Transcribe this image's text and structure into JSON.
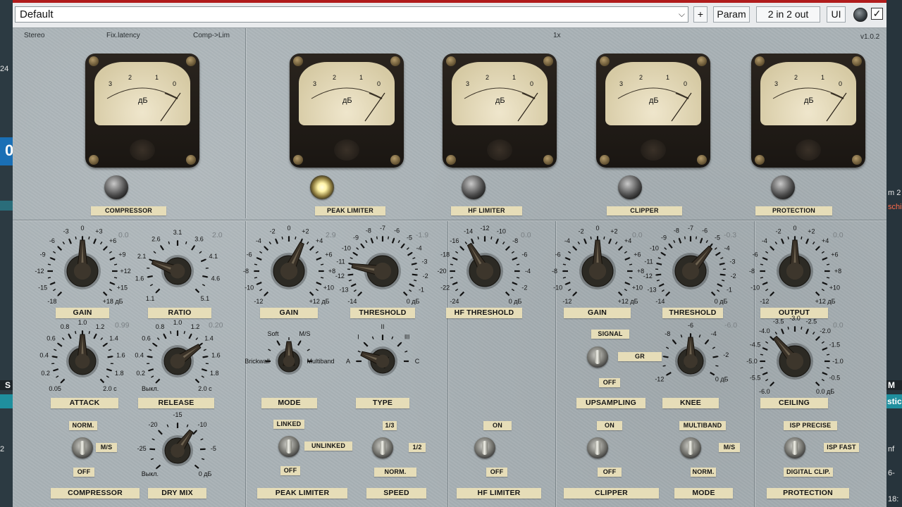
{
  "host": {
    "left_number": "24",
    "left_blue_letter": "0",
    "left_bottom_char": "S",
    "left_bottom_num": "2",
    "right_bits": [
      "m 2",
      "schi",
      "M",
      "stic",
      "nf",
      "6-",
      "18:"
    ]
  },
  "titlebar": {
    "preset": "Default",
    "dropdown_glyph": "⌵",
    "add_label": "+",
    "param_label": "Param",
    "io_label": "2 in 2 out",
    "ui_label": "UI",
    "enabled_glyph": "✓"
  },
  "header": {
    "stereo": "Stereo",
    "latency": "Fix.latency",
    "chain": "Comp->Lim",
    "oversample": "1x",
    "version": "v1.0.2"
  },
  "meters": [
    {
      "label": "COMPRESSOR",
      "lamp_on": false
    },
    {
      "label": "PEAK LIMITER",
      "lamp_on": true
    },
    {
      "label": "HF LIMITER",
      "lamp_on": false
    },
    {
      "label": "CLIPPER",
      "lamp_on": false
    },
    {
      "label": "PROTECTION",
      "lamp_on": false
    }
  ],
  "meter_scale": {
    "marks": [
      "3",
      "2",
      "1",
      "0"
    ],
    "unit": "дБ"
  },
  "knobs": {
    "comp_gain": {
      "label": "GAIN",
      "value": "0.0",
      "ticks": [
        "-18",
        "-15",
        "-12",
        "-9",
        "-6",
        "-3",
        "0",
        "+3",
        "+6",
        "+9",
        "+12",
        "+15",
        "+18"
      ],
      "unit": "дБ"
    },
    "comp_ratio": {
      "label": "RATIO",
      "value": "2.0",
      "ticks": [
        "1.1",
        "1.6",
        "2.1",
        "2.6",
        "3.1",
        "3.6",
        "4.1",
        "4.6",
        "5.1"
      ]
    },
    "comp_attack": {
      "label": "ATTACK",
      "value": "0.99",
      "ticks": [
        "0.05",
        "0.2",
        "0.4",
        "0.6",
        "0.8",
        "1.0",
        "1.2",
        "1.4",
        "1.6",
        "1.8",
        "2.0 с"
      ]
    },
    "comp_release": {
      "label": "RELEASE",
      "value": "0.20",
      "ticks": [
        "Выкл.",
        "0.2",
        "0.4",
        "0.6",
        "0.8",
        "1.0",
        "1.2",
        "1.4",
        "1.6",
        "1.8",
        "2.0 с"
      ]
    },
    "dry_mix": {
      "label": "DRY MIX",
      "ticks": [
        "Выкл.",
        "-25",
        "-20",
        "-15",
        "-10",
        "-5",
        "0"
      ],
      "unit": "дБ"
    },
    "pl_gain": {
      "label": "GAIN",
      "value": "2.9",
      "ticks": [
        "-12",
        "-10",
        "-8",
        "-6",
        "-4",
        "-2",
        "0",
        "+2",
        "+4",
        "+6",
        "+8",
        "+10",
        "+12"
      ],
      "unit": "дБ"
    },
    "pl_threshold": {
      "label": "THRESHOLD",
      "value": "-1.9",
      "ticks": [
        "-14",
        "-13",
        "-12",
        "-11",
        "-10",
        "-9",
        "-8",
        "-7",
        "-6",
        "-5",
        "-4",
        "-3",
        "-2",
        "-1",
        "0"
      ],
      "unit": "дБ"
    },
    "pl_mode": {
      "label": "MODE",
      "ticks": [
        "Brickwall",
        "Soft",
        "M/S",
        "Multiband"
      ]
    },
    "pl_type": {
      "label": "TYPE",
      "ticks": [
        "A",
        "I",
        "II",
        "III",
        "C"
      ]
    },
    "hf_threshold": {
      "label": "HF THRESHOLD",
      "value": "0.0",
      "ticks": [
        "-24",
        "-22",
        "-20",
        "-18",
        "-16",
        "-14",
        "-12",
        "-10",
        "-8",
        "-6",
        "-4",
        "-2",
        "0"
      ],
      "unit": "дБ"
    },
    "cl_gain": {
      "label": "GAIN",
      "value": "0.0",
      "ticks": [
        "-12",
        "-10",
        "-8",
        "-6",
        "-4",
        "-2",
        "0",
        "+2",
        "+4",
        "+6",
        "+8",
        "+10",
        "+12"
      ],
      "unit": "дБ"
    },
    "cl_threshold": {
      "label": "THRESHOLD",
      "value": "-0.3",
      "ticks": [
        "-14",
        "-13",
        "-12",
        "-11",
        "-10",
        "-9",
        "-8",
        "-7",
        "-6",
        "-5",
        "-4",
        "-3",
        "-2",
        "-1",
        "0"
      ],
      "unit": "дБ"
    },
    "cl_knee": {
      "label": "KNEE",
      "value": "-6.0",
      "ticks": [
        "-12",
        "-10",
        "-8",
        "-6",
        "-4",
        "-2",
        "0"
      ],
      "unit": "дБ"
    },
    "pr_output": {
      "label": "OUTPUT",
      "value": "0.0",
      "ticks": [
        "-12",
        "-10",
        "-8",
        "-6",
        "-4",
        "-2",
        "0",
        "+2",
        "+4",
        "+6",
        "+8",
        "+10",
        "+12"
      ],
      "unit": "дБ"
    },
    "pr_ceiling": {
      "label": "CEILING",
      "value": "0.0",
      "ticks": [
        "-6.0",
        "-5.5",
        "-5.0",
        "-4.5",
        "-4.0",
        "-3.5",
        "-3.0",
        "-2.5",
        "-2.0",
        "-1.5",
        "-1.0",
        "-0.5",
        "0.0"
      ],
      "unit": "дБ"
    }
  },
  "switches": {
    "comp_mode": {
      "top": "NORM.",
      "right": "M/S",
      "bottom": "OFF",
      "label": "COMPRESSOR"
    },
    "pl_link": {
      "top": "LINKED",
      "right": "UNLINKED",
      "bottom": "OFF",
      "label": "PEAK LIMITER"
    },
    "pl_speed": {
      "top": "1/3",
      "right": "1/2",
      "bottom": "NORM.",
      "label": "SPEED"
    },
    "hf_onoff": {
      "top": "ON",
      "bottom": "OFF",
      "label": "HF LIMITER"
    },
    "cl_signal": {
      "top": "SIGNAL",
      "right": "GR",
      "bottom": "OFF",
      "label": "UPSAMPLING"
    },
    "cl_onoff": {
      "top": "ON",
      "bottom": "OFF",
      "label": "CLIPPER"
    },
    "cl_mode": {
      "top": "MULTIBAND",
      "right": "M/S",
      "bottom": "NORM.",
      "label": "MODE"
    },
    "pr_isp": {
      "top": "ISP PRECISE",
      "right": "ISP FAST",
      "bottom": "DIGITAL CLIP.",
      "label": "PROTECTION"
    }
  }
}
